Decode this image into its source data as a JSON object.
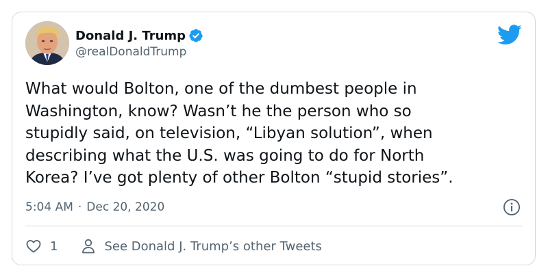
{
  "author": {
    "display_name": "Donald J. Trump",
    "handle": "@realDonaldTrump",
    "verified": true,
    "avatar_icon": "avatar-photo"
  },
  "tweet": {
    "text": "What would Bolton, one of the dumbest people in\nWashington, know? Wasn’t he the person who so\nstupidly said, on television, “Libyan solution”, when\ndescribing what the U.S. was going to do for North\nKorea? I’ve got plenty of other Bolton “stupid stories”.",
    "time": "5:04 AM",
    "separator": "·",
    "date": "Dec 20, 2020"
  },
  "actions": {
    "like_count": "1",
    "profile_link_label": "See Donald J. Trump’s other Tweets"
  },
  "icons": {
    "brand": "twitter-bird-icon",
    "verified": "verified-badge-icon",
    "info": "info-icon",
    "like": "heart-icon",
    "profile": "person-icon"
  },
  "colors": {
    "brand": "#1d9bf0",
    "text_primary": "#0f1419",
    "text_secondary": "#536471",
    "border": "#cfd9de"
  }
}
